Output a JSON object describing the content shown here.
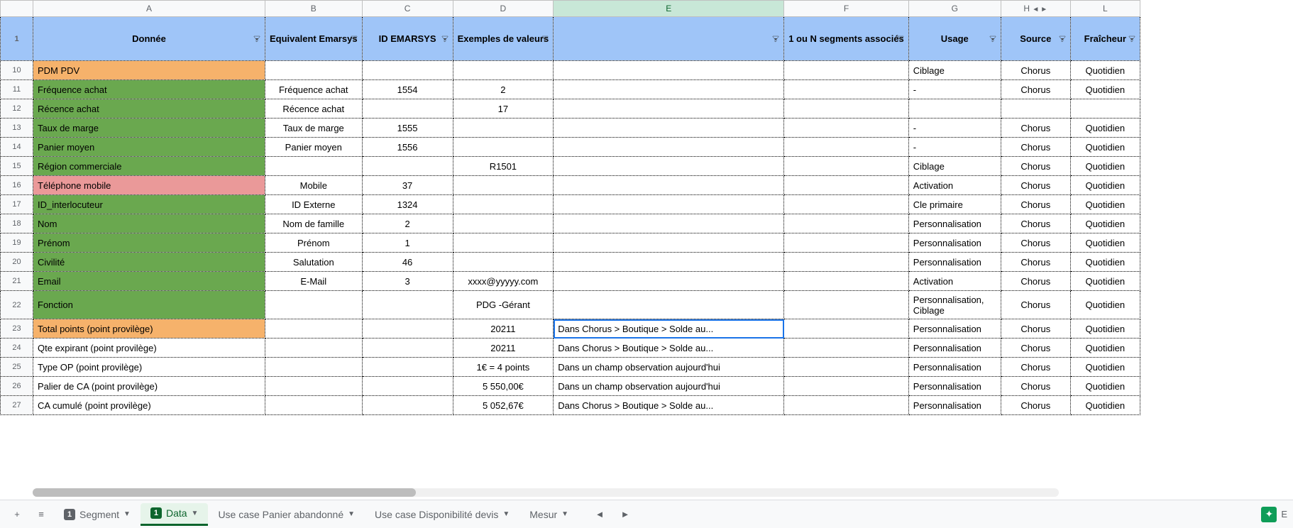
{
  "columns": [
    "A",
    "B",
    "C",
    "D",
    "E",
    "F",
    "G",
    "H",
    "L"
  ],
  "columnNavArrows": {
    "left": "◄",
    "right": "►"
  },
  "headerRow": {
    "rowNum": "1",
    "cells": {
      "A": "Donnée",
      "B": "Equivalent Emarsys",
      "C": "ID EMARSYS",
      "D": "Exemples de valeurs",
      "E": "",
      "F": "1 ou N segments associés",
      "G": "Usage",
      "H": "Source",
      "L": "Fraîcheur"
    }
  },
  "rows": [
    {
      "num": "10",
      "bg": "orange",
      "A": "PDM PDV",
      "B": "",
      "C": "",
      "D": "",
      "E": "",
      "F": "",
      "G": "Ciblage",
      "H": "Chorus",
      "L": "Quotidien"
    },
    {
      "num": "11",
      "bg": "green",
      "A": "Fréquence achat",
      "B": "Fréquence achat",
      "C": "1554",
      "D": "2",
      "E": "",
      "F": "",
      "G": "-",
      "H": "Chorus",
      "L": "Quotidien"
    },
    {
      "num": "12",
      "bg": "green",
      "A": "Récence achat",
      "B": "Récence achat",
      "C": "",
      "D": "17",
      "E": "",
      "F": "",
      "G": "",
      "H": "",
      "L": ""
    },
    {
      "num": "13",
      "bg": "green",
      "A": "Taux de marge",
      "B": "Taux de marge",
      "C": "1555",
      "D": "",
      "E": "",
      "F": "",
      "G": "-",
      "H": "Chorus",
      "L": "Quotidien"
    },
    {
      "num": "14",
      "bg": "green",
      "A": "Panier moyen",
      "B": "Panier moyen",
      "C": "1556",
      "D": "",
      "E": "",
      "F": "",
      "G": "-",
      "H": "Chorus",
      "L": "Quotidien"
    },
    {
      "num": "15",
      "bg": "green",
      "A": "Région commerciale",
      "B": "",
      "C": "",
      "D": "R1501",
      "E": "",
      "F": "",
      "G": "Ciblage",
      "H": "Chorus",
      "L": "Quotidien"
    },
    {
      "num": "16",
      "bg": "pink",
      "A": "Téléphone mobile",
      "B": "Mobile",
      "C": "37",
      "D": "",
      "E": "",
      "F": "",
      "G": "Activation",
      "H": "Chorus",
      "L": "Quotidien"
    },
    {
      "num": "17",
      "bg": "green",
      "A": "ID_interlocuteur",
      "B": "ID Externe",
      "C": "1324",
      "D": "",
      "E": "",
      "F": "",
      "G": "Cle primaire",
      "H": "Chorus",
      "L": "Quotidien"
    },
    {
      "num": "18",
      "bg": "green",
      "A": "Nom",
      "B": "Nom de famille",
      "C": "2",
      "D": "",
      "E": "",
      "F": "",
      "G": "Personnalisation",
      "H": "Chorus",
      "L": "Quotidien"
    },
    {
      "num": "19",
      "bg": "green",
      "A": "Prénom",
      "B": "Prénom",
      "C": "1",
      "D": "",
      "E": "",
      "F": "",
      "G": "Personnalisation",
      "H": "Chorus",
      "L": "Quotidien"
    },
    {
      "num": "20",
      "bg": "green",
      "A": "Civilité",
      "B": "Salutation",
      "C": "46",
      "D": "",
      "E": "",
      "F": "",
      "G": "Personnalisation",
      "H": "Chorus",
      "L": "Quotidien"
    },
    {
      "num": "21",
      "bg": "green",
      "A": "Email",
      "B": "E-Mail",
      "C": "3",
      "D": "xxxx@yyyyy.com",
      "E": "",
      "F": "",
      "G": "Activation",
      "H": "Chorus",
      "L": "Quotidien"
    },
    {
      "num": "22",
      "bg": "green",
      "tall": true,
      "A": "Fonction",
      "B": "",
      "C": "",
      "D": "PDG -Gérant",
      "E": "",
      "F": "",
      "G": "Personnalisation, Ciblage",
      "H": "Chorus",
      "L": "Quotidien"
    },
    {
      "num": "23",
      "bg": "orange",
      "A": "Total points (point provilège)",
      "B": "",
      "C": "",
      "D": "20211",
      "E": "Dans Chorus > Boutique         > Solde au...",
      "selectedE": true,
      "F": "",
      "G": "Personnalisation",
      "H": "Chorus",
      "L": "Quotidien"
    },
    {
      "num": "24",
      "bg": "",
      "A": "Qte expirant (point provilège)",
      "B": "",
      "C": "",
      "D": "20211",
      "E": "Dans Chorus > Boutique         > Solde au...",
      "F": "",
      "G": "Personnalisation",
      "H": "Chorus",
      "L": "Quotidien"
    },
    {
      "num": "25",
      "bg": "",
      "A": "Type OP (point provilège)",
      "B": "",
      "C": "",
      "D": "1€ = 4 points",
      "E": "Dans un champ observation aujourd'hui",
      "F": "",
      "G": "Personnalisation",
      "H": "Chorus",
      "L": "Quotidien"
    },
    {
      "num": "26",
      "bg": "",
      "A": "Palier de CA (point provilège)",
      "B": "",
      "C": "",
      "D": "5 550,00€",
      "E": "Dans un champ observation aujourd'hui",
      "F": "",
      "G": "Personnalisation",
      "H": "Chorus",
      "L": "Quotidien"
    },
    {
      "num": "27",
      "bg": "",
      "A": "CA cumulé (point provilège)",
      "B": "",
      "C": "",
      "D": "5 052,67€",
      "E": "Dans Chorus > Boutique         > Solde au...",
      "F": "",
      "G": "Personnalisation",
      "H": "Chorus",
      "L": "Quotidien",
      "cutoff": true
    }
  ],
  "tabs": [
    {
      "label": "Segment",
      "badge": "1",
      "active": false
    },
    {
      "label": "Data",
      "badge": "1",
      "active": true
    },
    {
      "label": "Use case Panier abandonné",
      "badge": "",
      "active": false
    },
    {
      "label": "Use case Disponibilité devis",
      "badge": "",
      "active": false
    },
    {
      "label": "Mesur",
      "badge": "",
      "active": false,
      "truncated": true
    }
  ],
  "tabAdd": "+",
  "tabMenu": "≡",
  "tabNavLeft": "◄",
  "tabNavRight": "►",
  "exploreLabel": "E",
  "columnAlign": {
    "B": "center",
    "C": "center",
    "D": "center",
    "F": "center",
    "H": "center",
    "L": "center"
  }
}
